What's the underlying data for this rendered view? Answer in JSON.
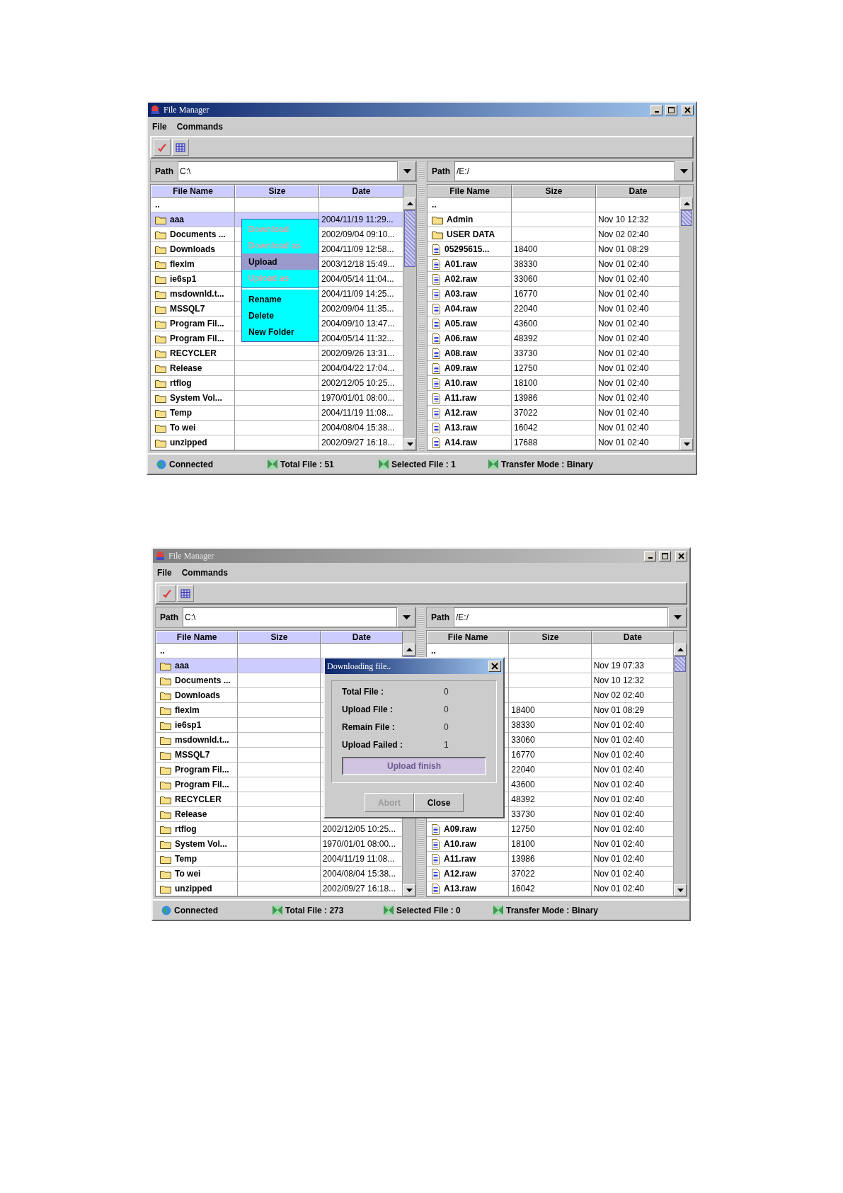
{
  "windows": [
    {
      "title": "File Manager",
      "active": true,
      "menu": [
        "File",
        "Commands"
      ],
      "panes": [
        {
          "path_label": "Path",
          "path": "C:\\",
          "active": true,
          "columns": [
            "File Name",
            "Size",
            "Date"
          ],
          "rows": [
            {
              "name": "..",
              "selected": false
            },
            {
              "name": "aaa",
              "kind": "folder",
              "date": "2004/11/19 11:29...",
              "selected": true
            },
            {
              "name": "Documents ...",
              "kind": "folder",
              "date": "2002/09/04 09:10...",
              "selected": false
            },
            {
              "name": "Downloads",
              "kind": "folder",
              "date": "2004/11/09 12:58...",
              "selected": false
            },
            {
              "name": "flexlm",
              "kind": "folder",
              "date": "2003/12/18 15:49...",
              "selected": false
            },
            {
              "name": "ie6sp1",
              "kind": "folder",
              "date": "2004/05/14 11:04...",
              "selected": false
            },
            {
              "name": "msdownld.t...",
              "kind": "folder",
              "date": "2004/11/09 14:25...",
              "selected": false
            },
            {
              "name": "MSSQL7",
              "kind": "folder",
              "date": "2002/09/04 11:35...",
              "selected": false
            },
            {
              "name": "Program Fil...",
              "kind": "folder",
              "date": "2004/09/10 13:47...",
              "selected": false
            },
            {
              "name": "Program Fil...",
              "kind": "folder",
              "date": "2004/05/14 11:32...",
              "selected": false
            },
            {
              "name": "RECYCLER",
              "kind": "folder",
              "date": "2002/09/26 13:31...",
              "selected": false
            },
            {
              "name": "Release",
              "kind": "folder",
              "date": "2004/04/22 17:04...",
              "selected": false
            },
            {
              "name": "rtflog",
              "kind": "folder",
              "date": "2002/12/05 10:25...",
              "selected": false
            },
            {
              "name": "System Vol...",
              "kind": "folder",
              "date": "1970/01/01 08:00...",
              "selected": false
            },
            {
              "name": "Temp",
              "kind": "folder",
              "date": "2004/11/19 11:08...",
              "selected": false
            },
            {
              "name": "To wei",
              "kind": "folder",
              "date": "2004/08/04 15:38...",
              "selected": false
            },
            {
              "name": "unzipped",
              "kind": "folder",
              "date": "2002/09/27 16:18...",
              "selected": false
            }
          ]
        },
        {
          "path_label": "Path",
          "path": "/E:/",
          "active": false,
          "columns": [
            "File Name",
            "Size",
            "Date"
          ],
          "rows": [
            {
              "name": "..",
              "selected": false
            },
            {
              "name": "Admin",
              "kind": "folder",
              "date": "Nov 10 12:32",
              "selected": false
            },
            {
              "name": "USER DATA",
              "kind": "folder",
              "date": "Nov 02 02:40",
              "selected": false
            },
            {
              "name": "05295615...",
              "kind": "file",
              "size": "18400",
              "date": "Nov 01 08:29",
              "selected": false
            },
            {
              "name": "A01.raw",
              "kind": "file",
              "size": "38330",
              "date": "Nov 01 02:40",
              "selected": false
            },
            {
              "name": "A02.raw",
              "kind": "file",
              "size": "33060",
              "date": "Nov 01 02:40",
              "selected": false
            },
            {
              "name": "A03.raw",
              "kind": "file",
              "size": "16770",
              "date": "Nov 01 02:40",
              "selected": false
            },
            {
              "name": "A04.raw",
              "kind": "file",
              "size": "22040",
              "date": "Nov 01 02:40",
              "selected": false
            },
            {
              "name": "A05.raw",
              "kind": "file",
              "size": "43600",
              "date": "Nov 01 02:40",
              "selected": false
            },
            {
              "name": "A06.raw",
              "kind": "file",
              "size": "48392",
              "date": "Nov 01 02:40",
              "selected": false
            },
            {
              "name": "A08.raw",
              "kind": "file",
              "size": "33730",
              "date": "Nov 01 02:40",
              "selected": false
            },
            {
              "name": "A09.raw",
              "kind": "file",
              "size": "12750",
              "date": "Nov 01 02:40",
              "selected": false
            },
            {
              "name": "A10.raw",
              "kind": "file",
              "size": "18100",
              "date": "Nov 01 02:40",
              "selected": false
            },
            {
              "name": "A11.raw",
              "kind": "file",
              "size": "13986",
              "date": "Nov 01 02:40",
              "selected": false
            },
            {
              "name": "A12.raw",
              "kind": "file",
              "size": "37022",
              "date": "Nov 01 02:40",
              "selected": false
            },
            {
              "name": "A13.raw",
              "kind": "file",
              "size": "16042",
              "date": "Nov 01 02:40",
              "selected": false
            },
            {
              "name": "A14.raw",
              "kind": "file",
              "size": "17688",
              "date": "Nov 01 02:40",
              "selected": false
            }
          ]
        }
      ],
      "status_bar": [
        {
          "kind": "globe",
          "text": "Connected"
        },
        {
          "kind": "square",
          "text": "Total File : 51"
        },
        {
          "kind": "square",
          "text": "Selected File : 1"
        },
        {
          "kind": "square",
          "text": "Transfer Mode : Binary"
        }
      ],
      "context_menu": {
        "items": [
          {
            "kind": "item",
            "label": "Download",
            "disabled": true,
            "selected": false
          },
          {
            "kind": "item",
            "label": "Download as",
            "disabled": true,
            "selected": false
          },
          {
            "kind": "item",
            "label": "Upload",
            "disabled": false,
            "selected": true
          },
          {
            "kind": "item",
            "label": "Upload as",
            "disabled": true,
            "selected": false
          },
          {
            "kind": "separator"
          },
          {
            "kind": "item",
            "label": "Rename",
            "disabled": false,
            "selected": false
          },
          {
            "kind": "item",
            "label": "Delete",
            "disabled": false,
            "selected": false
          },
          {
            "kind": "item",
            "label": "New Folder",
            "disabled": false,
            "selected": false
          }
        ]
      }
    },
    {
      "title": "File Manager",
      "active": false,
      "menu": [
        "File",
        "Commands"
      ],
      "panes": [
        {
          "path_label": "Path",
          "path": "C:\\",
          "active": true,
          "columns": [
            "File Name",
            "Size",
            "Date"
          ],
          "rows": [
            {
              "name": "..",
              "selected": false
            },
            {
              "name": "aaa",
              "kind": "folder",
              "selected": true
            },
            {
              "name": "Documents ...",
              "kind": "folder",
              "selected": false
            },
            {
              "name": "Downloads",
              "kind": "folder",
              "selected": false
            },
            {
              "name": "flexlm",
              "kind": "folder",
              "selected": false
            },
            {
              "name": "ie6sp1",
              "kind": "folder",
              "selected": false
            },
            {
              "name": "msdownld.t...",
              "kind": "folder",
              "selected": false
            },
            {
              "name": "MSSQL7",
              "kind": "folder",
              "selected": false
            },
            {
              "name": "Program Fil...",
              "kind": "folder",
              "selected": false
            },
            {
              "name": "Program Fil...",
              "kind": "folder",
              "selected": false
            },
            {
              "name": "RECYCLER",
              "kind": "folder",
              "selected": false
            },
            {
              "name": "Release",
              "kind": "folder",
              "selected": false
            },
            {
              "name": "rtflog",
              "kind": "folder",
              "date": "2002/12/05 10:25...",
              "selected": false
            },
            {
              "name": "System Vol...",
              "kind": "folder",
              "date": "1970/01/01 08:00...",
              "selected": false
            },
            {
              "name": "Temp",
              "kind": "folder",
              "date": "2004/11/19 11:08...",
              "selected": false
            },
            {
              "name": "To wei",
              "kind": "folder",
              "date": "2004/08/04 15:38...",
              "selected": false
            },
            {
              "name": "unzipped",
              "kind": "folder",
              "date": "2002/09/27 16:18...",
              "selected": false
            }
          ]
        },
        {
          "path_label": "Path",
          "path": "/E:/",
          "active": false,
          "columns": [
            "File Name",
            "Size",
            "Date"
          ],
          "rows": [
            {
              "name": "..",
              "selected": false
            },
            {
              "date": "Nov 19 07:33",
              "selected": false
            },
            {
              "date": "Nov 10 12:32",
              "selected": false
            },
            {
              "date": "Nov 02 02:40",
              "selected": false
            },
            {
              "size": "18400",
              "date": "Nov 01 08:29",
              "selected": false
            },
            {
              "size": "38330",
              "date": "Nov 01 02:40",
              "selected": false
            },
            {
              "size": "33060",
              "date": "Nov 01 02:40",
              "selected": false
            },
            {
              "size": "16770",
              "date": "Nov 01 02:40",
              "selected": false
            },
            {
              "size": "22040",
              "date": "Nov 01 02:40",
              "selected": false
            },
            {
              "size": "43600",
              "date": "Nov 01 02:40",
              "selected": false
            },
            {
              "size": "48392",
              "date": "Nov 01 02:40",
              "selected": false
            },
            {
              "size": "33730",
              "date": "Nov 01 02:40",
              "selected": false
            },
            {
              "name": "A09.raw",
              "kind": "file",
              "size": "12750",
              "date": "Nov 01 02:40",
              "selected": false
            },
            {
              "name": "A10.raw",
              "kind": "file",
              "size": "18100",
              "date": "Nov 01 02:40",
              "selected": false
            },
            {
              "name": "A11.raw",
              "kind": "file",
              "size": "13986",
              "date": "Nov 01 02:40",
              "selected": false
            },
            {
              "name": "A12.raw",
              "kind": "file",
              "size": "37022",
              "date": "Nov 01 02:40",
              "selected": false
            },
            {
              "name": "A13.raw",
              "kind": "file",
              "size": "16042",
              "date": "Nov 01 02:40",
              "selected": false
            }
          ]
        }
      ],
      "status_bar": [
        {
          "kind": "globe",
          "text": "Connected"
        },
        {
          "kind": "square",
          "text": "Total File : 273"
        },
        {
          "kind": "square",
          "text": "Selected File : 0"
        },
        {
          "kind": "square",
          "text": "Transfer Mode : Binary"
        }
      ],
      "dialog": {
        "title": "Downloading file..",
        "active": true,
        "fields": [
          {
            "label": "Total File :",
            "value": "0"
          },
          {
            "label": "Upload File :",
            "value": "0"
          },
          {
            "label": "Remain File :",
            "value": "0"
          },
          {
            "label": "Upload Failed :",
            "value": "1"
          }
        ],
        "progress": {
          "level": 1,
          "text": "Upload finish"
        },
        "buttons": [
          {
            "label": "Abort",
            "disabled": true
          },
          {
            "label": "Close",
            "disabled": false
          }
        ]
      }
    }
  ]
}
